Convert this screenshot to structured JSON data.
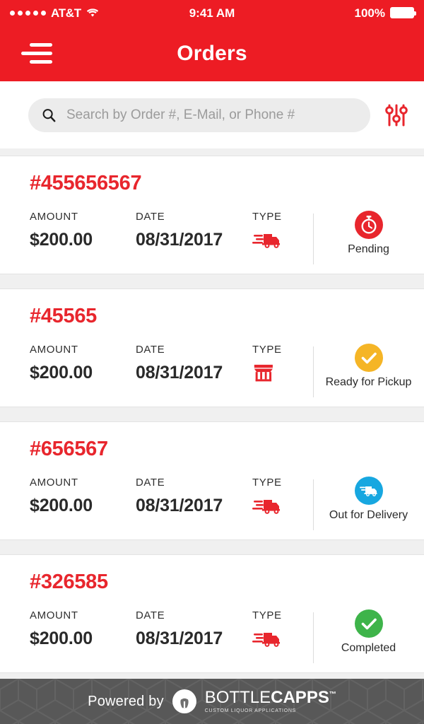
{
  "status_bar": {
    "carrier": "AT&T",
    "signal_dots": 5,
    "wifi_icon": "wifi-icon",
    "time": "9:41 AM",
    "battery_percent": "100%",
    "battery_icon": "battery-full-icon"
  },
  "header": {
    "menu_icon": "hamburger-menu-icon",
    "title": "Orders",
    "background_color": "#ed1c24"
  },
  "search": {
    "icon": "search-icon",
    "placeholder": "Search by Order #, E-Mail, or Phone #",
    "value": "",
    "filter_icon": "filter-sliders-icon"
  },
  "labels": {
    "amount": "AMOUNT",
    "date": "DATE",
    "type": "TYPE"
  },
  "orders": [
    {
      "id": "#455656567",
      "amount": "$200.00",
      "date": "08/31/2017",
      "type_icon": "delivery-truck-icon",
      "type": "Delivery",
      "status": "Pending",
      "status_icon": "stopwatch-icon",
      "status_color": "#e8262d"
    },
    {
      "id": "#45565",
      "amount": "$200.00",
      "date": "08/31/2017",
      "type_icon": "storefront-icon",
      "type": "Pickup",
      "status": "Ready for Pickup",
      "status_icon": "check-circle-icon",
      "status_color": "#f5b526"
    },
    {
      "id": "#656567",
      "amount": "$200.00",
      "date": "08/31/2017",
      "type_icon": "delivery-truck-icon",
      "type": "Delivery",
      "status": "Out for Delivery",
      "status_icon": "truck-circle-icon",
      "status_color": "#17a7e0"
    },
    {
      "id": "#326585",
      "amount": "$200.00",
      "date": "08/31/2017",
      "type_icon": "delivery-truck-icon",
      "type": "Delivery",
      "status": "Completed",
      "status_icon": "check-circle-icon",
      "status_color": "#3eb44a"
    }
  ],
  "footer": {
    "powered_by": "Powered by",
    "brand_mark_icon": "bottlecapps-logo-icon",
    "brand_first": "BOTTLE",
    "brand_second": "CAPPS",
    "brand_tm": "™",
    "brand_tagline": "CUSTOM LIQUOR APPLICATIONS",
    "background_color": "#585858"
  },
  "theme": {
    "accent": "#ed1c24",
    "order_id_color": "#e8262d"
  }
}
